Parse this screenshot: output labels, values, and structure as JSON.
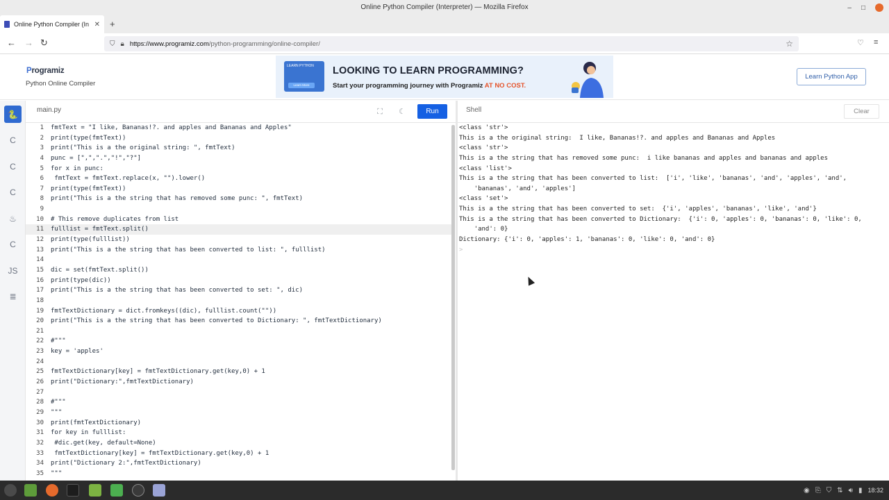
{
  "window": {
    "title": "Online Python Compiler (Interpreter) — Mozilla Firefox",
    "controls": [
      "–",
      "□"
    ]
  },
  "browser": {
    "tab_title": "Online Python Compiler (In",
    "tab_close": "✕",
    "new_tab": "+",
    "url_host": "https://www.programiz.com",
    "url_path": "/python-programming/online-compiler/"
  },
  "site": {
    "logo_p": "P",
    "logo_rest": "rogramiz",
    "subtitle": "Python Online Compiler",
    "banner_book_label": "LEARN PYTHON",
    "banner_book_btn": "Learn More",
    "banner_heading": "LOOKING TO LEARN PROGRAMMING?",
    "banner_sub": "Start your programming journey with Programiz ",
    "banner_sub_highlight": "AT NO COST.",
    "learn_app_button": "Learn Python App",
    "accent_color": "#1560e3",
    "highlight_color": "#e5542b"
  },
  "sidebar": {
    "items": [
      {
        "name": "python",
        "glyph": "🐍"
      },
      {
        "name": "c",
        "glyph": "C"
      },
      {
        "name": "cpp",
        "glyph": "C"
      },
      {
        "name": "csharp",
        "glyph": "C"
      },
      {
        "name": "java",
        "glyph": "♨"
      },
      {
        "name": "go",
        "glyph": "C"
      },
      {
        "name": "javascript",
        "glyph": "JS"
      },
      {
        "name": "sql",
        "glyph": "≣"
      }
    ]
  },
  "editor": {
    "file_name": "main.py",
    "fullscreen_icon": "⛶",
    "theme_icon": "☾",
    "run_label": "Run",
    "highlighted_line": 11,
    "lines": [
      "fmtText = \"I like, Bananas!?. and apples and Bananas and Apples\"",
      "print(type(fmtText))",
      "print(\"This is a the original string: \", fmtText)",
      "punc = [\",\",\".\",\"!\",\"?\"]",
      "for x in punc:",
      " fmtText = fmtText.replace(x, \"\").lower()",
      "print(type(fmtText))",
      "print(\"This is a the string that has removed some punc: \", fmtText)",
      "",
      "# This remove duplicates from list",
      "fulllist = fmtText.split()",
      "print(type(fulllist))",
      "print(\"This is a the string that has been converted to list: \", fulllist)",
      "",
      "dic = set(fmtText.split())",
      "print(type(dic))",
      "print(\"This is a the string that has been converted to set: \", dic)",
      "",
      "fmtTextDictionary = dict.fromkeys((dic), fulllist.count(\"\"))",
      "print(\"This is a the string that has been converted to Dictionary: \", fmtTextDictionary)",
      "",
      "#\"\"\"",
      "key = 'apples'",
      "",
      "fmtTextDictionary[key] = fmtTextDictionary.get(key,0) + 1",
      "print(\"Dictionary:\",fmtTextDictionary)",
      "",
      "#\"\"\"",
      "\"\"\"",
      "print(fmtTextDictionary)",
      "for key in fulllist:",
      " #dic.get(key, default=None)",
      " fmtTextDictionary[key] = fmtTextDictionary.get(key,0) + 1",
      "print(\"Dictionary 2:\",fmtTextDictionary)",
      "\"\"\""
    ]
  },
  "shell": {
    "title": "Shell",
    "clear_label": "Clear",
    "lines": [
      "<class 'str'>",
      "This is a the original string:  I like, Bananas!?. and apples and Bananas and Apples",
      "<class 'str'>",
      "This is a the string that has removed some punc:  i like bananas and apples and bananas and apples",
      "<class 'list'>",
      "This is a the string that has been converted to list:  ['i', 'like', 'bananas', 'and', 'apples', 'and',",
      "    'bananas', 'and', 'apples']",
      "<class 'set'>",
      "This is a the string that has been converted to set:  {'i', 'apples', 'bananas', 'like', 'and'}",
      "This is a the string that has been converted to Dictionary:  {'i': 0, 'apples': 0, 'bananas': 0, 'like': 0,",
      "    'and': 0}",
      "Dictionary: {'i': 0, 'apples': 1, 'bananas': 0, 'like': 0, 'and': 0}"
    ],
    "prompt": ">"
  },
  "taskbar": {
    "clock": "18:32"
  }
}
